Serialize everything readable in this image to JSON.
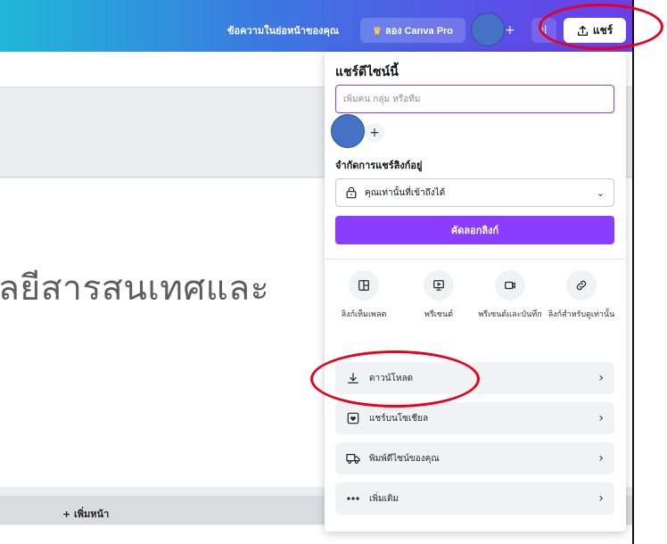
{
  "header": {
    "promo_text": "ข้อความในย่อหน้าของคุณ",
    "pro_button": "ลอง Canva Pro",
    "plus": "+",
    "stats_glyph": "ıl",
    "share_button": "แชร์"
  },
  "canvas": {
    "page_text": "ลยีสารสนเทศและ",
    "add_page": "+ เพิ่มหน้า"
  },
  "share_panel": {
    "title": "แชร์ดีไซน์นี้",
    "invite_placeholder": "เพิ่มคน กลุ่ม หรือทีม",
    "plus": "+",
    "restrict_label": "จำกัดการแชร์ลิงก์อยู่",
    "access_value": "คุณเท่านั้นที่เข้าถึงได้",
    "copy_link": "คัดลอกลิงก์",
    "options": [
      {
        "label": "ลิงก์เท็มเพลต",
        "icon": "template-icon"
      },
      {
        "label": "พรีเซนต์",
        "icon": "present-icon"
      },
      {
        "label": "พรีเซนต์และบันทึก",
        "icon": "record-icon"
      },
      {
        "label": "ลิงก์สำหรับดูเท่านั้น",
        "icon": "link-icon"
      }
    ],
    "rows": [
      {
        "label": "ดาวน์โหลด",
        "icon": "download-icon"
      },
      {
        "label": "แชร์บนโซเชียล",
        "icon": "heart-icon"
      },
      {
        "label": "พิมพ์ดีไซน์ของคุณ",
        "icon": "truck-icon"
      },
      {
        "label": "เพิ่มเติม",
        "icon": "more-icon"
      }
    ]
  },
  "colors": {
    "accent": "#8b3dff",
    "annotation": "#e8001c",
    "avatar": "#4472c4"
  }
}
